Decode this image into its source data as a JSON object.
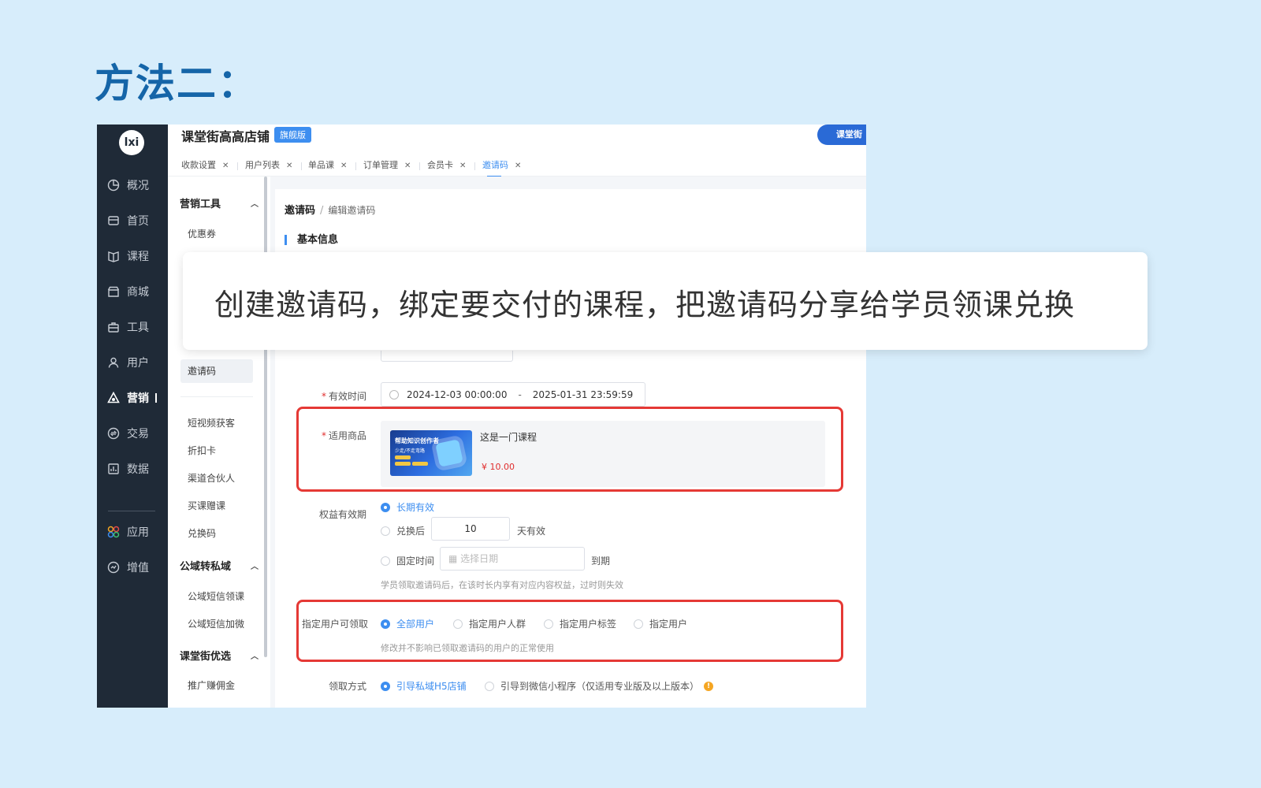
{
  "slide": {
    "title": "方法二："
  },
  "overlay": {
    "caption": "创建邀请码，绑定要交付的课程，把邀请码分享给学员领课兑换"
  },
  "app": {
    "logo": "lxi",
    "shop_title": "课堂街高高店铺",
    "shop_badge": "旗舰版",
    "corner_logo": "课堂街",
    "nav": [
      {
        "label": "概况",
        "icon": "pie-chart-icon"
      },
      {
        "label": "首页",
        "icon": "store-icon"
      },
      {
        "label": "课程",
        "icon": "book-icon"
      },
      {
        "label": "商城",
        "icon": "shop-icon"
      },
      {
        "label": "工具",
        "icon": "toolbox-icon"
      },
      {
        "label": "用户",
        "icon": "user-icon"
      },
      {
        "label": "营销",
        "icon": "marketing-icon",
        "active": true
      },
      {
        "label": "交易",
        "icon": "exchange-icon"
      },
      {
        "label": "数据",
        "icon": "data-icon"
      },
      {
        "label": "应用",
        "icon": "apps-icon"
      },
      {
        "label": "增值",
        "icon": "value-added-icon"
      }
    ],
    "tabs": [
      {
        "label": "收款设置"
      },
      {
        "label": "用户列表"
      },
      {
        "label": "单品课"
      },
      {
        "label": "订单管理"
      },
      {
        "label": "会员卡"
      },
      {
        "label": "邀请码",
        "active": true
      }
    ],
    "subnav": {
      "group1": "营销工具",
      "items1": [
        "优惠券",
        "邀请码",
        "短视频获客",
        "折扣卡",
        "渠道合伙人",
        "买课赠课",
        "兑换码"
      ],
      "group2": "公域转私域",
      "items2": [
        "公域短信领课",
        "公域短信加微"
      ],
      "group3": "课堂街优选",
      "items3": [
        "推广赚佣金"
      ]
    },
    "form": {
      "breadcrumb": [
        "邀请码",
        "编辑邀请码"
      ],
      "section_title": "基本信息",
      "valid_time_label": "有效时间",
      "valid_start": "2024-12-03 00:00:00",
      "valid_end": "2025-01-31 23:59:59",
      "product_label": "适用商品",
      "product_thumb_title": "帮助知识创作者",
      "product_thumb_sub": "少走/不走弯路",
      "product_name": "这是一门课程",
      "product_price": "¥ 10.00",
      "rights_label": "权益有效期",
      "rights_options": [
        "长期有效",
        "兑换后",
        "固定时间"
      ],
      "rights_days": "10",
      "rights_days_suffix": "天有效",
      "rights_date_placeholder": "选择日期",
      "rights_date_suffix": "到期",
      "rights_hint": "学员领取邀请码后，在该时长内享有对应内容权益，过时则失效",
      "user_label": "指定用户可领取",
      "user_options": [
        "全部用户",
        "指定用户人群",
        "指定用户标签",
        "指定用户"
      ],
      "user_hint": "修改并不影响已领取邀请码的用户的正常使用",
      "claim_label": "领取方式",
      "claim_options": [
        "引导私域H5店铺",
        "引导到微信小程序（仅适用专业版及以上版本）"
      ]
    }
  }
}
